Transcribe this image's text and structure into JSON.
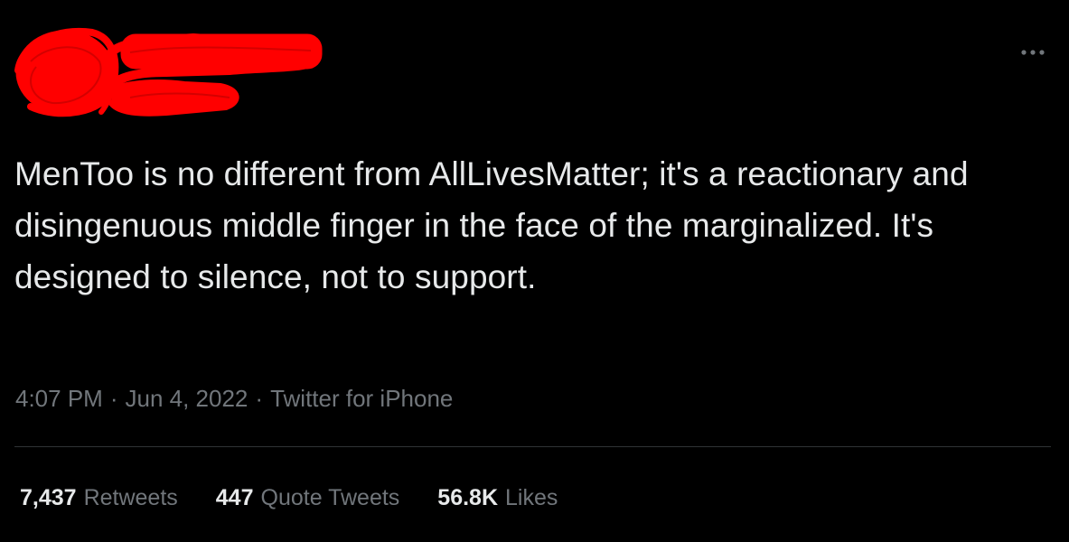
{
  "tweet": {
    "text": "MenToo is no different from AllLivesMatter; it's a reactionary and disingenuous middle finger in the face of the marginalized. It's designed to silence, not to support.",
    "time": "4:07 PM",
    "separator": "·",
    "date": "Jun 4, 2022",
    "source": "Twitter for iPhone"
  },
  "stats": {
    "retweets": {
      "count": "7,437",
      "label": "Retweets"
    },
    "quote_tweets": {
      "count": "447",
      "label": "Quote Tweets"
    },
    "likes": {
      "count": "56.8K",
      "label": "Likes"
    }
  },
  "icons": {
    "more": "more-horizontal-icon"
  },
  "colors": {
    "background": "#000000",
    "text": "#e7e9ea",
    "secondary": "#71767b",
    "divider": "#2f3336",
    "redaction": "#ff0000"
  }
}
